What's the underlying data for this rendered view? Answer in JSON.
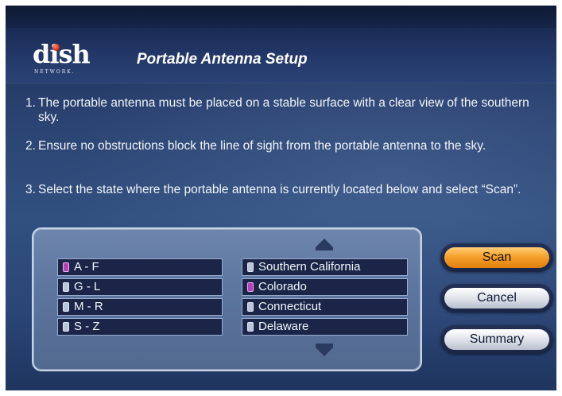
{
  "logo": {
    "word": "dish",
    "subtitle": "NETWORK."
  },
  "title": "Portable Antenna Setup",
  "instructions": [
    {
      "num": "1.",
      "text": "The portable antenna must be placed on a stable surface with a clear view of the southern sky."
    },
    {
      "num": "2.",
      "text": "Ensure no obstructions block the line of sight from the portable antenna to the sky."
    },
    {
      "num": "3.",
      "text": "Select the state where the portable antenna is currently located below and select “Scan”."
    }
  ],
  "ranges": [
    {
      "label": "A - F",
      "selected": true
    },
    {
      "label": "G - L",
      "selected": false
    },
    {
      "label": "M - R",
      "selected": false
    },
    {
      "label": "S - Z",
      "selected": false
    }
  ],
  "states": [
    {
      "label": "Southern California",
      "selected": false
    },
    {
      "label": "Colorado",
      "selected": true
    },
    {
      "label": "Connecticut",
      "selected": false
    },
    {
      "label": "Delaware",
      "selected": false
    }
  ],
  "buttons": {
    "scan": "Scan",
    "cancel": "Cancel",
    "summary": "Summary"
  },
  "colors": {
    "focus": "#f7a12b",
    "checkbox_selected": "#b640b8",
    "background": "#2a4271"
  }
}
